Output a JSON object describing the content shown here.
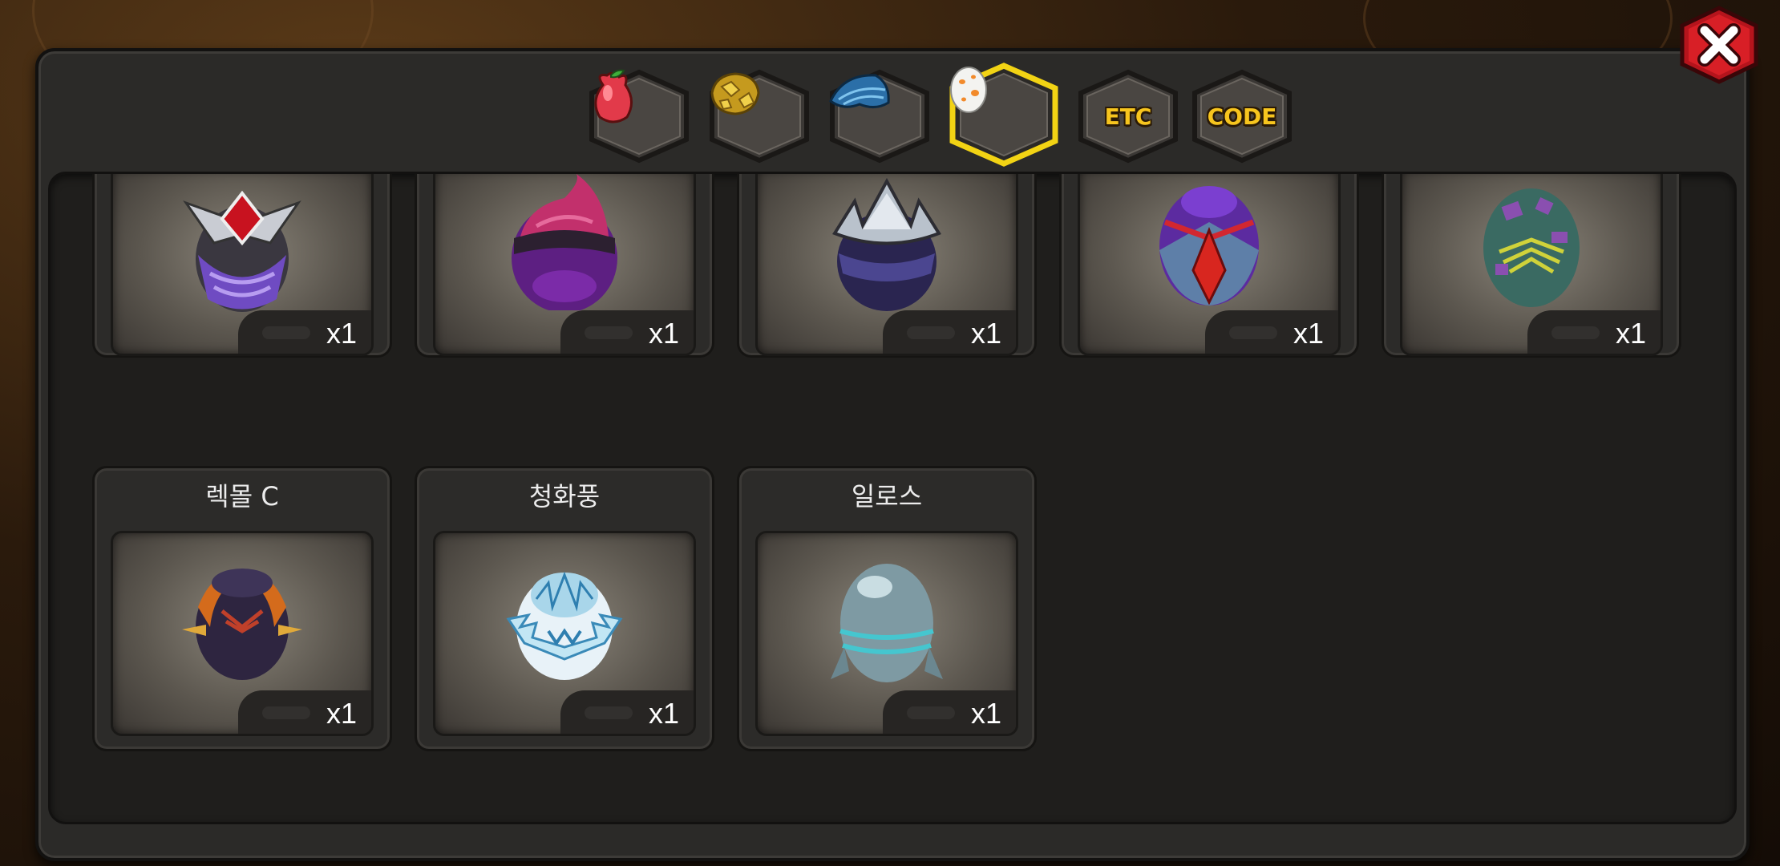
{
  "tabs": [
    {
      "icon": "fruit-icon",
      "label": "",
      "selected": false
    },
    {
      "icon": "gold-ore-icon",
      "label": "",
      "selected": false
    },
    {
      "icon": "blue-feather-icon",
      "label": "",
      "selected": false
    },
    {
      "icon": "egg-icon",
      "label": "",
      "selected": true
    },
    {
      "icon": "etc-icon",
      "label": "ETC",
      "selected": false
    },
    {
      "icon": "code-icon",
      "label": "CODE",
      "selected": false
    }
  ],
  "close_icon": "close-icon",
  "colors": {
    "tab_selected_border": "#f2d314",
    "tab_text": "#f7c51e",
    "close_red": "#d81f26"
  },
  "items": [
    {
      "name": "",
      "qty": "x1",
      "egg": "silver-red-gem-egg-icon"
    },
    {
      "name": "",
      "qty": "x1",
      "egg": "pink-purple-egg-icon"
    },
    {
      "name": "",
      "qty": "x1",
      "egg": "silver-spike-egg-icon"
    },
    {
      "name": "",
      "qty": "x1",
      "egg": "purple-red-beak-egg-icon"
    },
    {
      "name": "",
      "qty": "x1",
      "egg": "teal-purple-egg-icon"
    },
    {
      "name": "렉몰 C",
      "qty": "x1",
      "egg": "dark-flame-horn-egg-icon"
    },
    {
      "name": "청화풍",
      "qty": "x1",
      "egg": "white-ice-egg-icon"
    },
    {
      "name": "일로스",
      "qty": "x1",
      "egg": "teal-ring-egg-icon"
    }
  ]
}
